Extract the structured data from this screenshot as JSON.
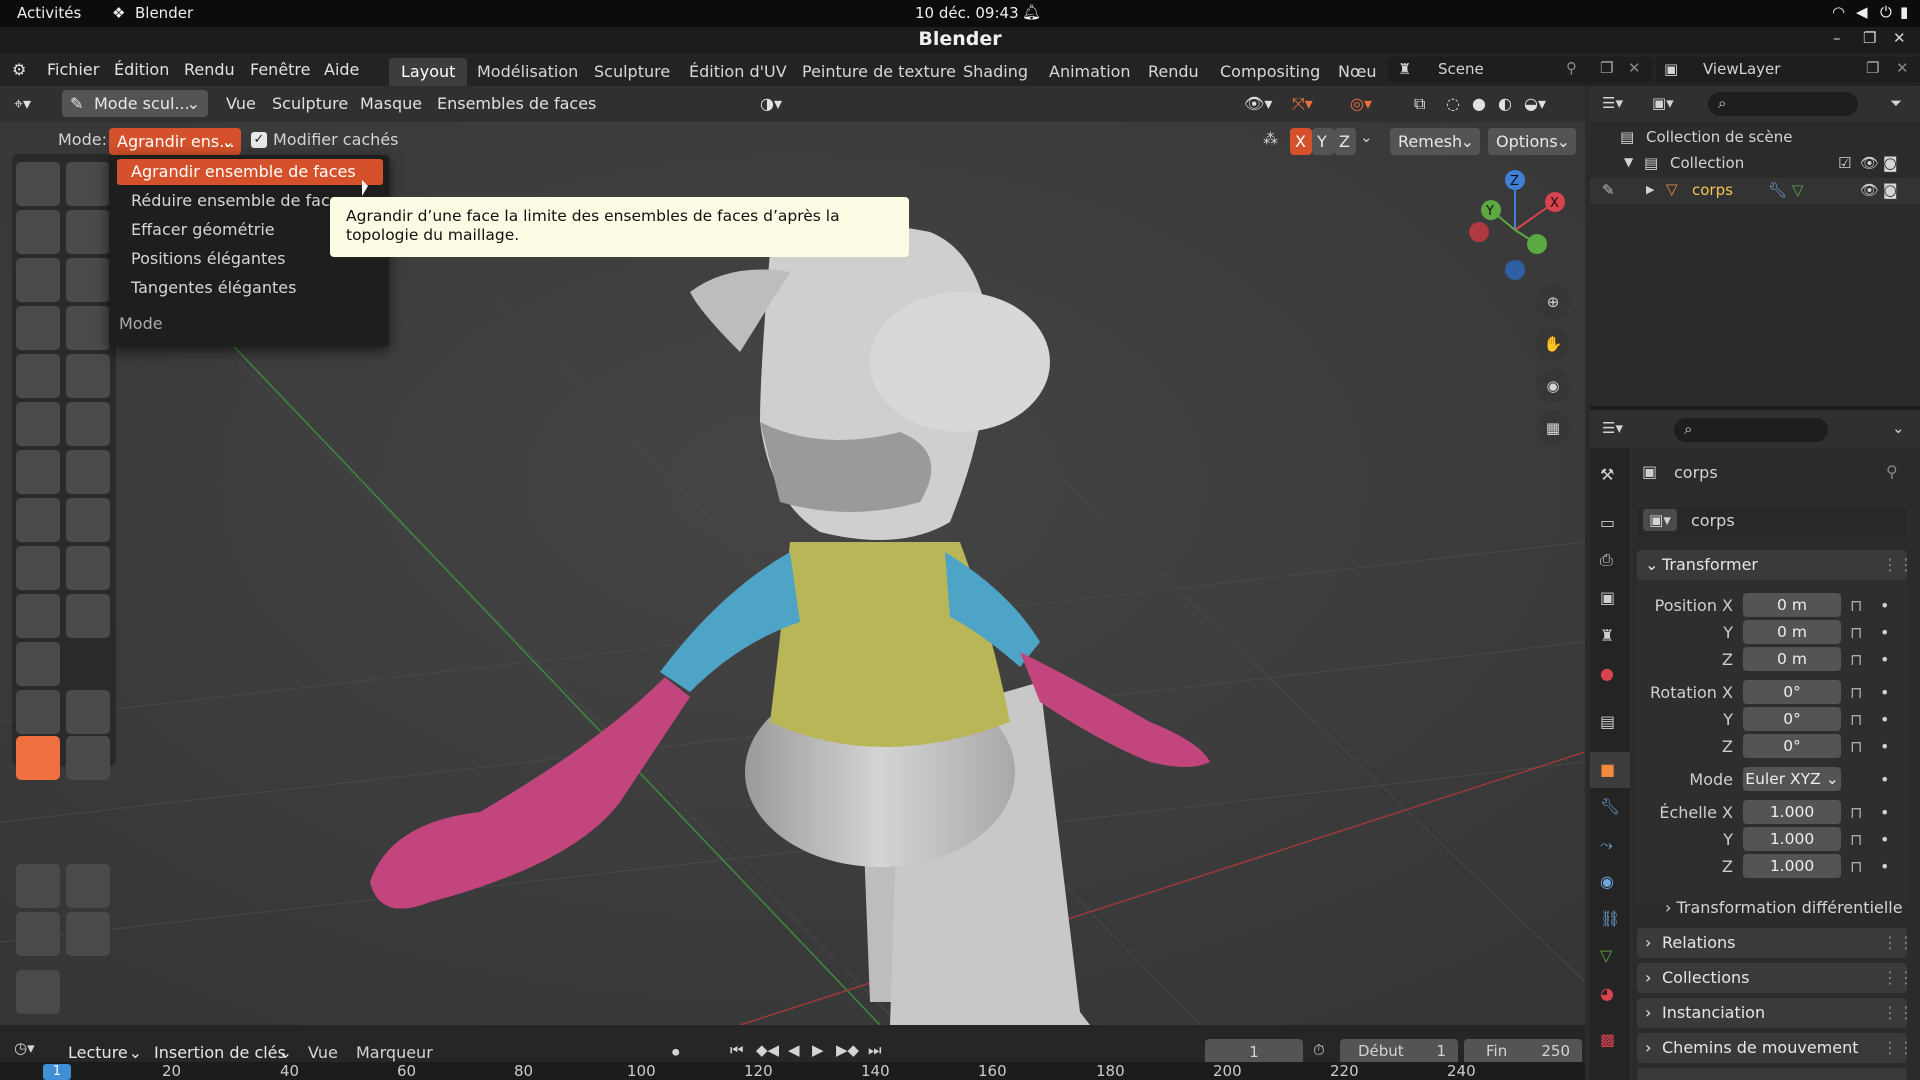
{
  "system_bar": {
    "activities": "Activités",
    "app": "Blender",
    "datetime": "10 déc. 09:43"
  },
  "window_title": "Blender",
  "menu": {
    "items": [
      "Fichier",
      "Édition",
      "Rendu",
      "Fenêtre",
      "Aide"
    ]
  },
  "workspace_tabs": [
    "Layout",
    "Modélisation",
    "Sculpture",
    "Édition d'UV",
    "Peinture de texture",
    "Shading",
    "Animation",
    "Rendu",
    "Compositing",
    "Nœu"
  ],
  "scene": {
    "name": "Scene",
    "view_layer": "ViewLayer"
  },
  "header": {
    "mode": "Mode scul...",
    "vue": "Vue",
    "sculpture": "Sculpture",
    "masque": "Masque",
    "ensembles": "Ensembles de faces"
  },
  "tool_header": {
    "mode_label": "Mode:",
    "mode_value": "Agrandir ens...",
    "modifier_hidden": "Modifier cachés",
    "x": "X",
    "y": "Y",
    "z": "Z",
    "remesh": "Remesh",
    "options": "Options"
  },
  "dropdown": {
    "items": [
      "Agrandir ensemble de faces",
      "Réduire ensemble de faces",
      "Effacer géométrie",
      "Positions élégantes",
      "Tangentes élégantes"
    ],
    "footer": "Mode"
  },
  "tooltip": "Agrandir d’une face la limite des ensembles de faces d’après la topologie du maillage.",
  "outliner": {
    "scene_collection": "Collection de scène",
    "collection": "Collection",
    "object": "corps"
  },
  "properties": {
    "object_name": "corps",
    "data_name": "corps",
    "transform_title": "Transformer",
    "position": {
      "label": "Position X",
      "x": "0 m",
      "y": "0 m",
      "z": "0 m"
    },
    "rotation": {
      "label": "Rotation X",
      "x": "0°",
      "y": "0°",
      "z": "0°"
    },
    "mode": {
      "label": "Mode",
      "value": "Euler XYZ"
    },
    "scale": {
      "label": "Échelle X",
      "x": "1.000",
      "y": "1.000",
      "z": "1.000"
    },
    "axis_y": "Y",
    "axis_z": "Z",
    "delta": "Transformation différentielle",
    "sections": [
      "Relations",
      "Collections",
      "Instanciation",
      "Chemins de mouvement"
    ]
  },
  "timeline": {
    "lecture": "Lecture",
    "insertion": "Insertion de clés",
    "vue": "Vue",
    "marqueur": "Marqueur",
    "current_frame": "1",
    "debut_label": "Début",
    "debut": "1",
    "fin_label": "Fin",
    "fin": "250"
  },
  "ruler": {
    "current": "1",
    "ticks": [
      "20",
      "40",
      "60",
      "80",
      "100",
      "120",
      "140",
      "160",
      "180",
      "200",
      "220",
      "240"
    ]
  },
  "gizmo": {
    "x": "X",
    "y": "Y",
    "z": "Z"
  },
  "colors": {
    "accent": "#d4512b",
    "active_tool": "#ef6f3e",
    "shirt": "#b9b657",
    "sleeve": "#4ea4c6",
    "glove": "#c2457d",
    "body": "#cfcfcf"
  }
}
